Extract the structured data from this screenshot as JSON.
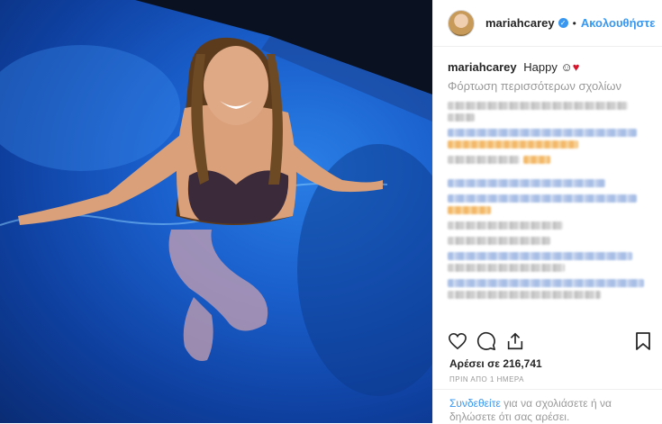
{
  "post": {
    "username": "mariahcarey",
    "follow_label": "Ακολουθήστε",
    "caption_user": "mariahcarey",
    "caption_text": "Happy",
    "caption_emoji": "☺",
    "caption_heart": "♥",
    "load_more": "Φόρτωση περισσότερων σχολίων",
    "likes": "Αρέσει σε 216,741",
    "time": "ΠΡΙΝ ΑΠΟ 1 ΗΜΕΡΑ",
    "login_link": "Συνδεθείτε",
    "login_text": " για να σχολιάσετε ή να δηλώσετε ότι σας αρέσει."
  },
  "icons": {
    "verified": "verified-badge-icon",
    "like": "heart-icon",
    "comment": "comment-icon",
    "share": "share-icon",
    "save": "bookmark-icon"
  },
  "colors": {
    "accent": "#3897f0",
    "heart": "#d8152b",
    "muted": "#999999"
  }
}
